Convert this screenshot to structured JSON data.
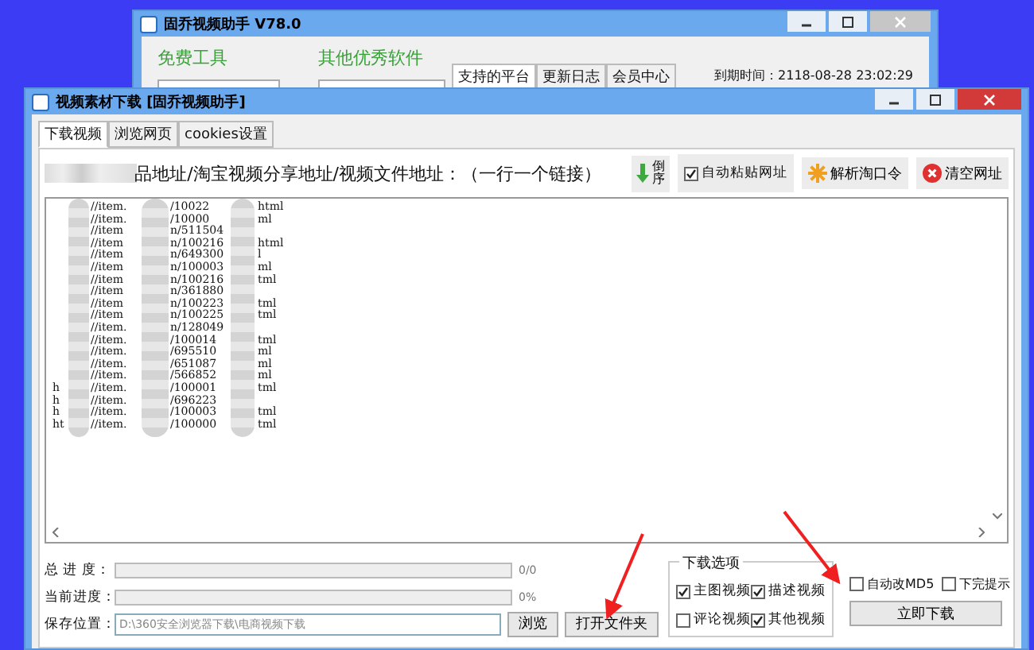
{
  "back_window": {
    "title": "固乔视频助手 V78.0",
    "section_1": "免费工具",
    "section_2": "其他优秀软件",
    "tabs": [
      {
        "label": "支持的平台",
        "selected": true
      },
      {
        "label": "更新日志",
        "selected": false
      },
      {
        "label": "会员中心",
        "selected": false
      }
    ],
    "expiry": "到期时间：2118-08-28 23:02:29"
  },
  "window": {
    "title": "视频素材下载 [固乔视频助手]"
  },
  "tabs": [
    {
      "label": "下载视频",
      "selected": true
    },
    {
      "label": "浏览网页",
      "selected": false
    },
    {
      "label": "cookies设置",
      "selected": false
    }
  ],
  "instruction": "品地址/淘宝视频分享地址/视频文件地址：（一行一个链接）",
  "toolbar": {
    "reverse": "倒序",
    "auto_paste": {
      "label": "自动粘贴网址",
      "checked": true
    },
    "parse": "解析淘口令",
    "clear": "清空网址"
  },
  "url_lines": [
    {
      "a": "//item.",
      "b": "/10022",
      "c": "html"
    },
    {
      "a": "//item.",
      "b": "/10000",
      "c": "ml"
    },
    {
      "a": "//item",
      "b": "n/511504"
    },
    {
      "a": "//item",
      "b": "n/100216",
      "c": "html"
    },
    {
      "a": "//item",
      "b": "n/649300",
      "c": "l"
    },
    {
      "a": "//item",
      "b": "n/100003",
      "c": "ml"
    },
    {
      "a": "//item",
      "b": "n/100216",
      "c": "tml"
    },
    {
      "a": "//item",
      "b": "n/361880"
    },
    {
      "a": "//item",
      "b": "n/100223",
      "c": "tml"
    },
    {
      "a": "//item",
      "b": "n/100225",
      "c": "tml"
    },
    {
      "a": "//item.",
      "b": "n/128049"
    },
    {
      "a": "//item.",
      "b": "/100014",
      "c": "tml"
    },
    {
      "a": "//item.",
      "b": "/695510",
      "c": "ml"
    },
    {
      "a": "//item.",
      "b": "/651087",
      "c": "ml"
    },
    {
      "a": "//item.",
      "b": "/566852",
      "c": "ml"
    },
    {
      "prefix": "h",
      "a": "//item.",
      "b": "/100001",
      "c": "tml"
    },
    {
      "prefix": "h",
      "a": "//item.",
      "b": "/696223"
    },
    {
      "prefix": "h",
      "a": "//item.",
      "b": "/100003",
      "c": "tml"
    },
    {
      "prefix": "ht",
      "a": "//item.",
      "b": "/100000",
      "c": "tml"
    }
  ],
  "progress": [
    {
      "label": "总 进 度：",
      "level": 0,
      "reading": "0/0"
    },
    {
      "label": "当前进度：",
      "level": 0,
      "reading": "0%"
    }
  ],
  "save": {
    "label": "保存位置：",
    "value": "D:\\360安全浏览器下载\\电商视频下载",
    "browse": "浏览",
    "open_folder": "打开文件夹"
  },
  "options": {
    "title": "下载选项",
    "items": [
      {
        "label": "主图视频",
        "checked": true
      },
      {
        "label": "描述视频",
        "checked": true
      },
      {
        "label": "评论视频",
        "checked": false
      },
      {
        "label": "其他视频",
        "checked": true
      }
    ]
  },
  "extra": [
    {
      "label": "自动改MD5",
      "checked": false
    },
    {
      "label": "下完提示",
      "checked": false
    }
  ],
  "download_button": "立即下载"
}
